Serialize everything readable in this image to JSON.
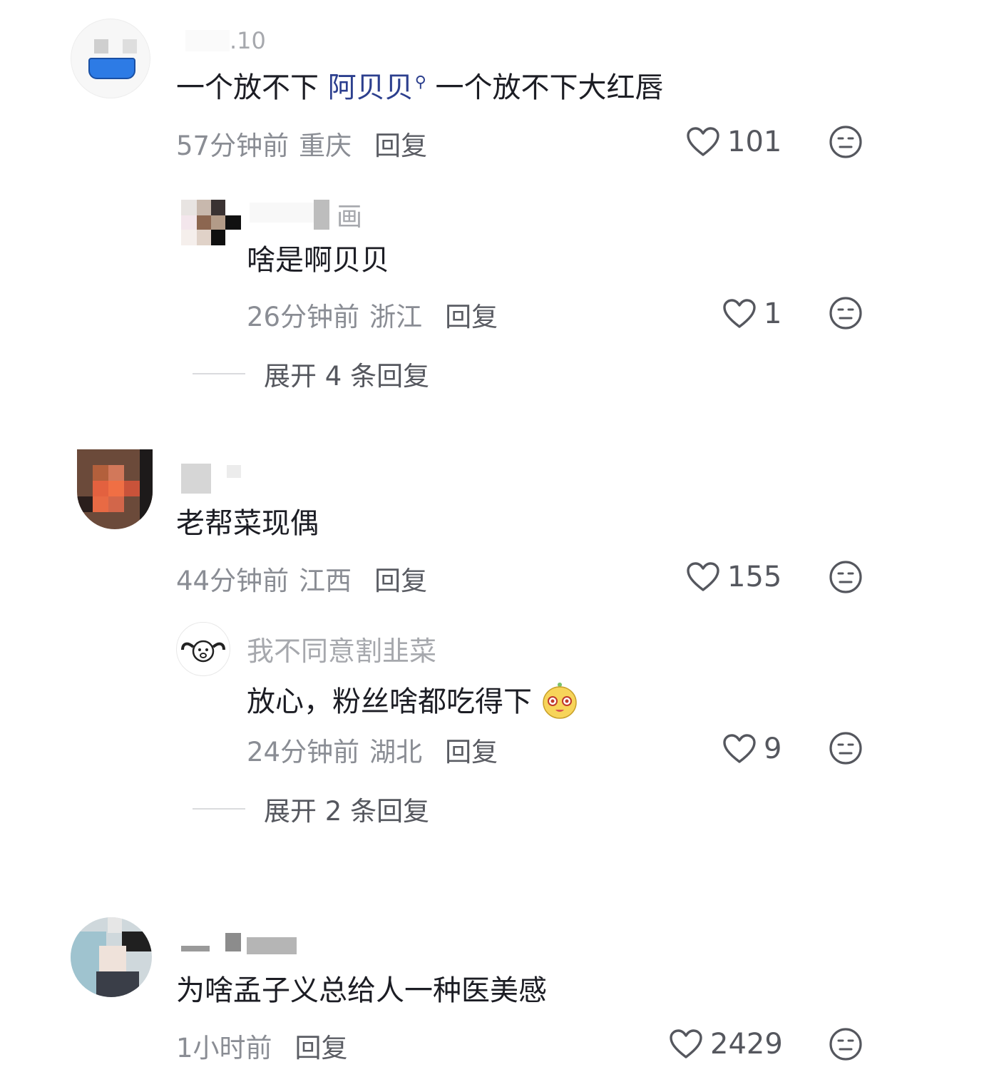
{
  "comments": [
    {
      "username_fragment": ".10",
      "text_before": "一个放不下 ",
      "mention": "阿贝贝",
      "text_after": " 一个放不下大红唇",
      "time": "57分钟前",
      "location": "重庆",
      "reply_label": "回复",
      "likes": "101",
      "reply": {
        "username_fragment": "画",
        "text": "啥是啊贝贝",
        "time": "26分钟前",
        "location": "浙江",
        "reply_label": "回复",
        "likes": "1"
      },
      "expand_label": "展开 4 条回复"
    },
    {
      "text": "老帮菜现偶",
      "time": "44分钟前",
      "location": "江西",
      "reply_label": "回复",
      "likes": "155",
      "reply": {
        "username": "我不同意割韭菜",
        "text": "放心，粉丝啥都吃得下",
        "time": "24分钟前",
        "location": "湖北",
        "reply_label": "回复",
        "likes": "9"
      },
      "expand_label": "展开 2 条回复"
    },
    {
      "text": "为啥孟子义总给人一种医美感",
      "time": "1小时前",
      "reply_label": "回复",
      "likes": "2429"
    }
  ],
  "icons": {
    "like": "heart-outline-icon",
    "dislike": "neutral-face-icon",
    "search": "search-icon",
    "emoji": "cartoon-face-emoji"
  },
  "colors": {
    "mention": "#2c3f8e",
    "meta": "#8a8d94"
  }
}
